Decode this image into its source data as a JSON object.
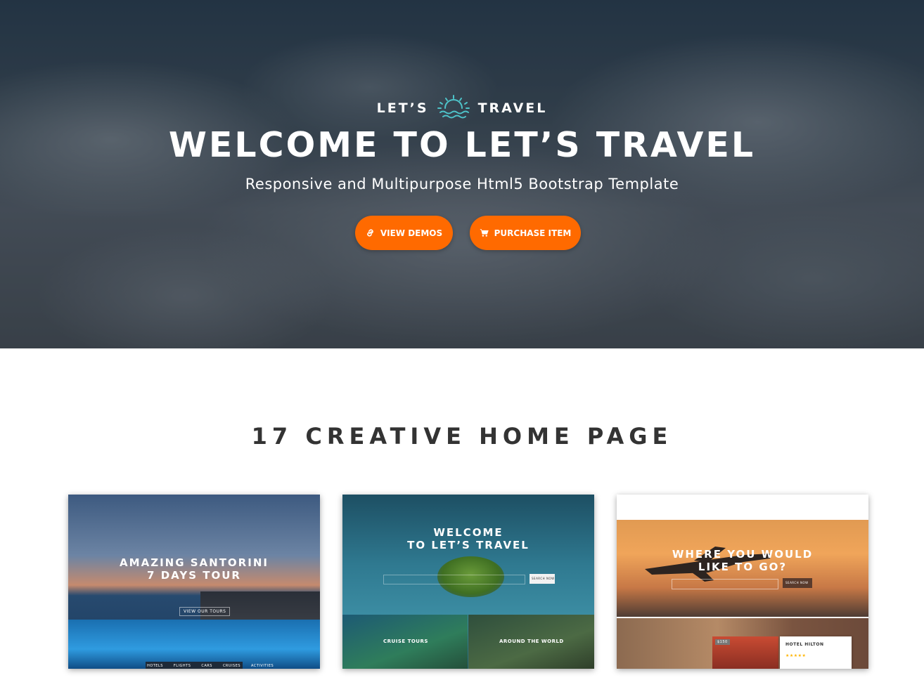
{
  "hero": {
    "logo_left": "LET’S",
    "logo_right": "TRAVEL",
    "title": "WELCOME TO LET’S TRAVEL",
    "subtitle": "Responsive and Multipurpose Html5 Bootstrap Template",
    "buttons": {
      "demos_label": "VIEW DEMOS",
      "purchase_label": "PURCHASE ITEM"
    }
  },
  "section": {
    "title": "17 CREATIVE HOME PAGE"
  },
  "demos": [
    {
      "headline_line1": "AMAZING SANTORINI",
      "headline_line2": "7 DAYS TOUR",
      "cta": "VIEW OUR TOURS",
      "tabs": [
        "HOTELS",
        "FLIGHTS",
        "CARS",
        "CRUISES",
        "ACTIVITIES"
      ]
    },
    {
      "headline_line1": "WELCOME",
      "headline_line2": "TO LET’S TRAVEL",
      "search_btn": "SEARCH NOW",
      "tile_left": "CRUISE TOURS",
      "tile_right": "AROUND THE WORLD"
    },
    {
      "headline_line1": "WHERE YOU WOULD",
      "headline_line2": "LIKE TO GO?",
      "search_btn": "SEARCH NOW",
      "hotel_name": "HOTEL HILTON",
      "hotel_badge": "$150"
    }
  ],
  "colors": {
    "accent": "#ff6a00",
    "logo_teal": "#4ec3c9"
  },
  "icons": {
    "demos_button": "link-icon",
    "purchase_button": "cart-icon",
    "logo": "sun-waves-icon"
  }
}
